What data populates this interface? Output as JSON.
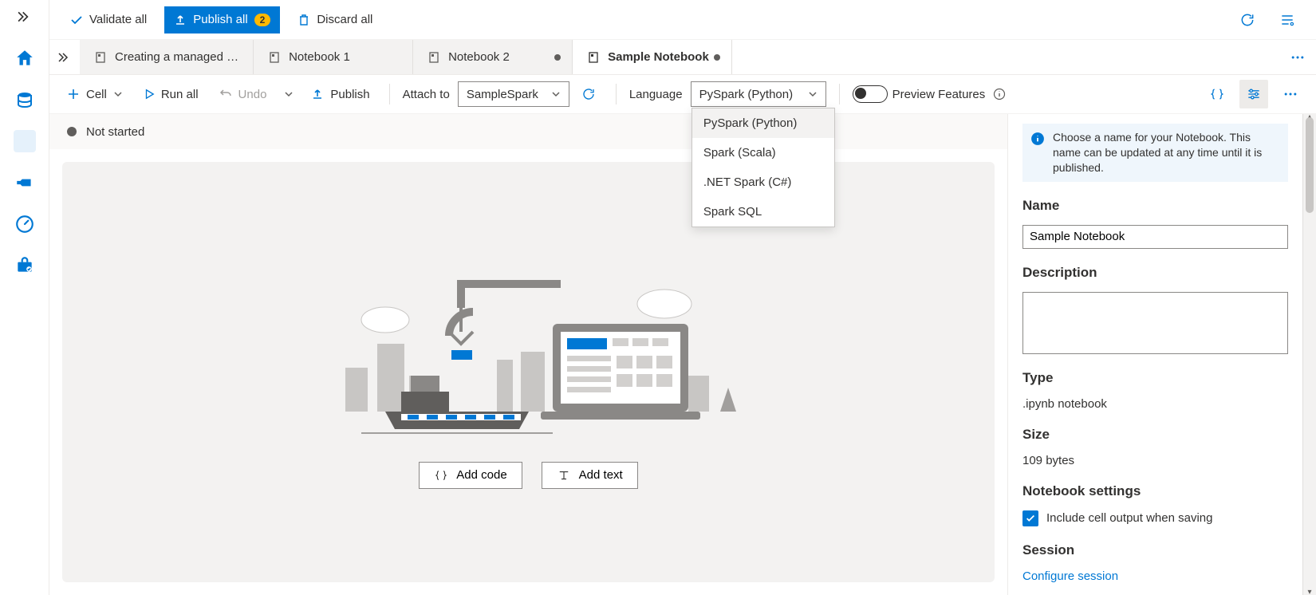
{
  "cmdbar": {
    "validate": "Validate all",
    "publish_all": "Publish all",
    "publish_badge": "2",
    "discard": "Discard all"
  },
  "tabs": [
    {
      "label": "Creating a managed …",
      "active": false,
      "dirty": false
    },
    {
      "label": "Notebook 1",
      "active": false,
      "dirty": false
    },
    {
      "label": "Notebook 2",
      "active": false,
      "dirty": true
    },
    {
      "label": "Sample Notebook",
      "active": true,
      "dirty": true
    }
  ],
  "nbbar": {
    "cell": "Cell",
    "run_all": "Run all",
    "undo": "Undo",
    "publish": "Publish",
    "attach_to": "Attach to",
    "attach_value": "SampleSpark",
    "language_label": "Language",
    "language_value": "PySpark (Python)",
    "language_options": [
      "PySpark (Python)",
      "Spark (Scala)",
      ".NET Spark (C#)",
      "Spark SQL"
    ],
    "preview": "Preview Features"
  },
  "status": {
    "text": "Not started"
  },
  "canvas": {
    "add_code": "Add code",
    "add_text": "Add text"
  },
  "panel": {
    "info": "Choose a name for your Notebook. This name can be updated at any time until it is published.",
    "name_label": "Name",
    "name_value": "Sample Notebook",
    "desc_label": "Description",
    "desc_value": "",
    "type_label": "Type",
    "type_value": ".ipynb notebook",
    "size_label": "Size",
    "size_value": "109 bytes",
    "settings_label": "Notebook settings",
    "include_output": "Include cell output when saving",
    "session_label": "Session",
    "configure_session": "Configure session"
  }
}
